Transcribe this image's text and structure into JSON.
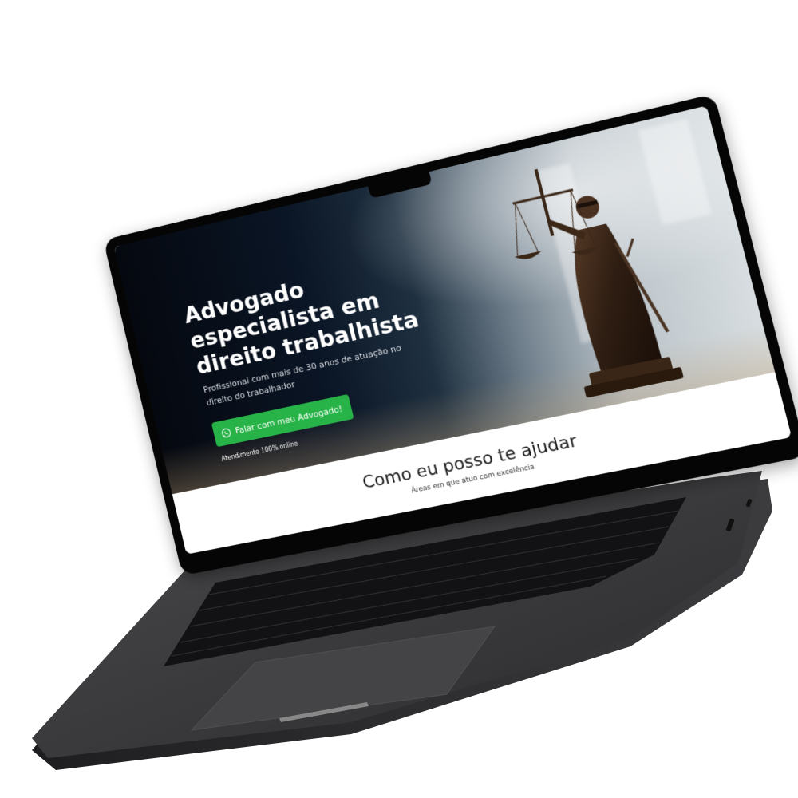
{
  "hero": {
    "title": "Advogado especialista em direito trabalhista",
    "subtitle": "Profissional com mais de 30 anos de atuação no direito do trabalhador",
    "cta_label": "Falar com meu Advogado!",
    "cta_icon": "whatsapp-icon",
    "cta_note": "Atendimento 100% online",
    "image": "lady-justice-statue"
  },
  "services": {
    "title": "Como eu posso te ajudar",
    "subtitle": "Áreas em que atuo com excelência"
  },
  "colors": {
    "cta": "#27b347",
    "hero_dark": "#05080f",
    "laptop_body": "#3a3a3c"
  }
}
